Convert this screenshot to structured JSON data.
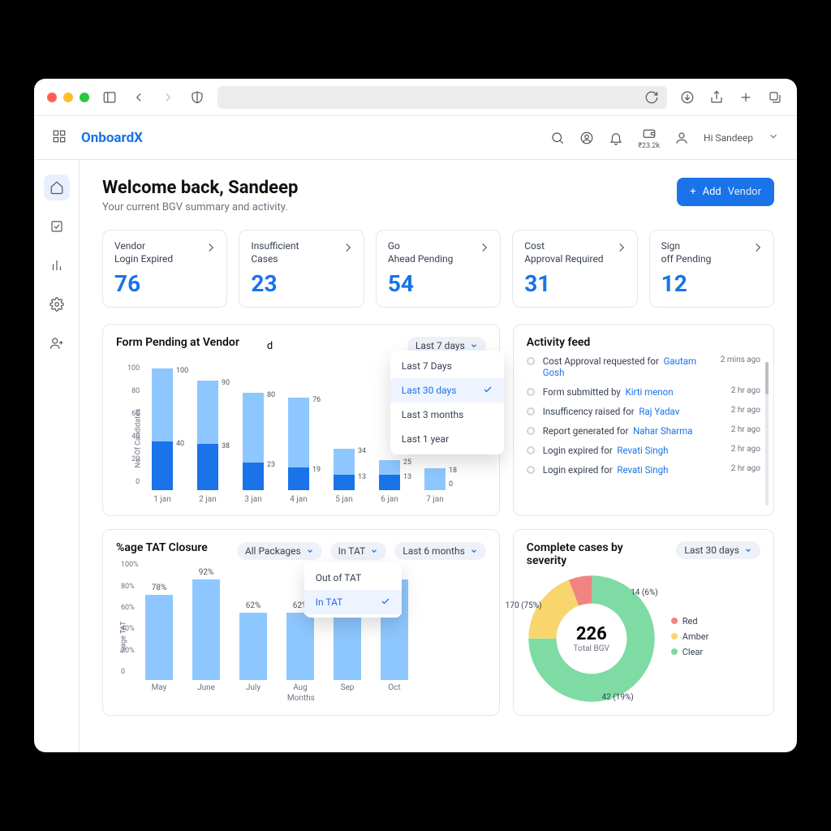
{
  "chrome": {
    "funds": "₹23.2k",
    "greeting": "Hi Sandeep"
  },
  "brand": "OnboardX",
  "header": {
    "title": "Welcome back, Sandeep",
    "subtitle": "Your current BGV summary and activity.",
    "add_label": "Add",
    "add_target": "Vendor"
  },
  "cards": [
    {
      "label": "Vendor Login Expired",
      "value": "76"
    },
    {
      "label": "Insufficient Cases",
      "value": "23"
    },
    {
      "label": "Go Ahead Pending",
      "value": "54"
    },
    {
      "label": "Cost Approval Required",
      "value": "31"
    },
    {
      "label": "Sign off Pending",
      "value": "12"
    }
  ],
  "form_pending": {
    "title": "Form Pending at Vendor",
    "extra_char": "d",
    "legend_visible": "No",
    "filter_label": "Last 7 days",
    "dropdown": {
      "options": [
        "Last 7 Days",
        "Last 30 days",
        "Last 3 months",
        "Last 1 year"
      ],
      "selected": "Last 30 days"
    },
    "ylabel": "No. Of Candidates",
    "yticks": [
      "100",
      "80",
      "60",
      "40",
      "20",
      "0"
    ]
  },
  "activity": {
    "title": "Activity feed",
    "items": [
      {
        "text": "Cost Approval requested for",
        "link": "Gautam Gosh",
        "time": "2 mins ago"
      },
      {
        "text": "Form submitted by",
        "link": "Kirti menon",
        "time": "2 hr ago"
      },
      {
        "text": "Insufficency raised for",
        "link": "Raj Yadav",
        "time": "2 hr ago"
      },
      {
        "text": "Report generated for",
        "link": "Nahar Sharma",
        "time": "2 hr ago"
      },
      {
        "text": "Login expired for",
        "link": "Revati  Singh",
        "time": "2 hr ago"
      },
      {
        "text": "Login expired for",
        "link": "Revati  Singh",
        "time": "2 hr ago"
      }
    ]
  },
  "tat": {
    "title": "%age TAT Closure",
    "filters": {
      "package": "All Packages",
      "scope": "In TAT",
      "range": "Last 6 months"
    },
    "dropdown": {
      "options": [
        "Out of TAT",
        "In TAT"
      ],
      "selected": "In TAT"
    },
    "xlabel": "Months",
    "ylabel": "%age TAT",
    "yticks": [
      "100%",
      "80%",
      "60%",
      "40%",
      "20%",
      "0"
    ]
  },
  "severity": {
    "title": "Complete cases by severity",
    "filter": "Last 30 days",
    "total": "226",
    "total_label": "Total BGV",
    "legend": [
      {
        "name": "Red",
        "color": "#f28383"
      },
      {
        "name": "Amber",
        "color": "#f8d66d"
      },
      {
        "name": "Clear",
        "color": "#7ddba3"
      }
    ],
    "slices": {
      "red": {
        "label": "14 (6%)"
      },
      "amber": {
        "label": "42 (19%)"
      },
      "clear": {
        "label": "170 (75%)"
      }
    }
  },
  "chart_data": [
    {
      "type": "bar",
      "title": "Form Pending at Vendor",
      "xlabel": "",
      "ylabel": "No. Of Candidates",
      "ylim": [
        0,
        100
      ],
      "categories": [
        "1 jan",
        "2 jan",
        "3 jan",
        "4 jan",
        "5 jan",
        "6 jan",
        "7 jan"
      ],
      "series": [
        {
          "name": "Dark",
          "values": [
            40,
            38,
            23,
            19,
            13,
            13,
            0
          ]
        },
        {
          "name": "Light",
          "values": [
            60,
            52,
            57,
            57,
            21,
            12,
            18
          ]
        }
      ],
      "data_labels": {
        "dark": [
          40,
          38,
          23,
          19,
          13,
          13,
          0
        ],
        "total": [
          100,
          90,
          80,
          76,
          34,
          25,
          18
        ]
      }
    },
    {
      "type": "bar",
      "title": "%age TAT Closure",
      "xlabel": "Months",
      "ylabel": "%age TAT",
      "ylim": [
        0,
        100
      ],
      "categories": [
        "May",
        "June",
        "July",
        "Aug",
        "Sep",
        "Oct"
      ],
      "series": [
        {
          "name": "In TAT",
          "values": [
            78,
            92,
            62,
            62,
            62,
            92
          ]
        }
      ]
    },
    {
      "type": "pie",
      "title": "Complete cases by severity",
      "total": 226,
      "slices": [
        {
          "name": "Red",
          "value": 14,
          "pct": 6
        },
        {
          "name": "Amber",
          "value": 42,
          "pct": 19
        },
        {
          "name": "Clear",
          "value": 170,
          "pct": 75
        }
      ]
    }
  ]
}
